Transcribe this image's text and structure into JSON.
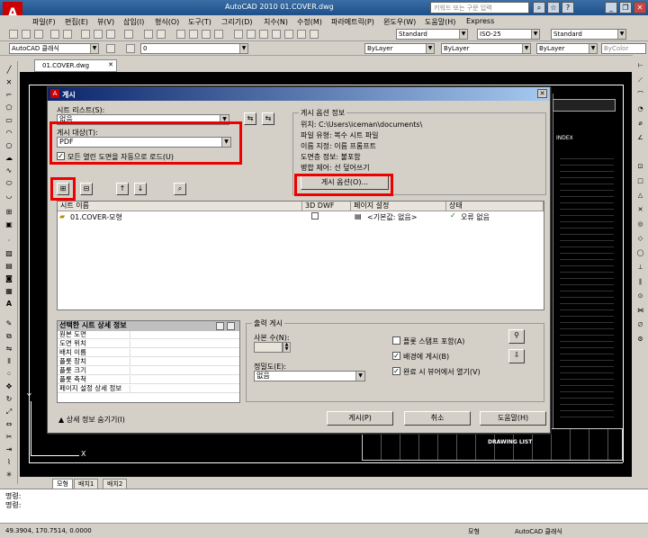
{
  "app": {
    "title": "AutoCAD 2010    01.COVER.dwg",
    "search_placeholder": "키워드 또는 구문 입력",
    "logo": "A"
  },
  "menu": [
    "파일(F)",
    "편집(E)",
    "뷰(V)",
    "삽입(I)",
    "형식(O)",
    "도구(T)",
    "그리기(D)",
    "치수(N)",
    "수정(M)",
    "파라메트릭(P)",
    "윈도우(W)",
    "도움말(H)",
    "Express"
  ],
  "toolbar": {
    "workspace": "AutoCAD 클래식",
    "text_style": "Standard",
    "dim_style": "ISO-25",
    "table_style": "Standard",
    "layer_value": "0",
    "color_value": "ByLayer",
    "linetype_value": "ByLayer",
    "lineweight_value": "ByLayer",
    "plot_value": "ByColor"
  },
  "document_tab": "01.COVER.dwg",
  "model_tabs": [
    "모형",
    "배치1",
    "배치2"
  ],
  "command_lines": [
    "명령:",
    "명령:"
  ],
  "status": {
    "coords": "49.3904, 170.7514, 0.0000",
    "mode": "모형",
    "workspace": "AutoCAD 클래식"
  },
  "dialog": {
    "title": "게시",
    "sheet_list_label": "시트 리스트(S):",
    "sheet_list_value": "없음",
    "publish_to_label": "게시 대상(T):",
    "publish_to_value": "PDF",
    "auto_load_label": "모든 열린 도면을 자동으로 로드(U)",
    "auto_load_checked": true,
    "options_info": {
      "heading": "게시 옵션 정보",
      "lines": [
        "위치: C:\\Users\\iceman\\documents\\",
        "파일 유형: 복수 시트 파일",
        "이름 지정: 이름 프롬프트",
        "도면층 정보: 불포함",
        "병합 제어: 선 덮어쓰기"
      ],
      "button": "게시 옵션(O)..."
    },
    "columns": [
      "시트 이름",
      "3D DWF",
      "페이지 설정",
      "상태"
    ],
    "rows": [
      {
        "name": "01.COVER-모형",
        "page_setup": "<기본값: 없음>",
        "status": "오류 없음"
      }
    ],
    "details": {
      "heading": "선택한 시트 상세 정보",
      "rows": [
        "원본 도면",
        "도면 위치",
        "배치 이름",
        "플롯 장치",
        "플롯 크기",
        "플롯 축척",
        "페이지 설정 상세 정보"
      ]
    },
    "output": {
      "heading": "출력 게시",
      "copies_label": "사본 수(N):",
      "copies_value": "",
      "precision_label": "정밀도(E):",
      "precision_value": "없음",
      "stamp_label": "플롯 스탬프 포함(A)",
      "stamp_checked": false,
      "background_label": "배경에 게시(B)",
      "background_checked": true,
      "open_viewer_label": "완료 시 뷰어에서 열기(V)",
      "open_viewer_checked": true
    },
    "hide_details": "상세 정보 숨기기(I)",
    "buttons": {
      "publish": "게시(P)",
      "cancel": "취소",
      "help": "도움말(H)"
    }
  },
  "drawing_text": {
    "sheet_title": "DRAWING LIST",
    "block_label": "INDEX"
  },
  "colors": {
    "highlight_box": "#e00000",
    "title_bar": "#0a246a",
    "canvas": "#000000"
  }
}
